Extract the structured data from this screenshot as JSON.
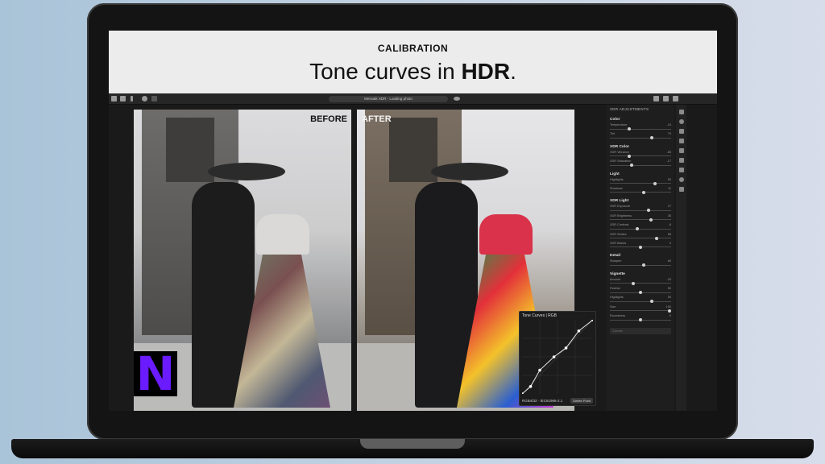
{
  "hero": {
    "eyebrow": "CALIBRATION",
    "title_prefix": "Tone curves in ",
    "title_bold": "HDR",
    "title_suffix": "."
  },
  "app": {
    "status_text": "Messaik XDR - Loading photo",
    "before_label": "BEFORE",
    "after_label": "AFTER",
    "logo_letter": "N",
    "tone_curves": {
      "title": "Tone Curves | RGB",
      "footer": "RGB4/32 · IEC61966-2.1",
      "reset_label": "Delete Point",
      "curve_points": [
        [
          0,
          0
        ],
        [
          0.12,
          0.1
        ],
        [
          0.25,
          0.32
        ],
        [
          0.45,
          0.5
        ],
        [
          0.62,
          0.62
        ],
        [
          0.8,
          0.85
        ],
        [
          1,
          1
        ]
      ]
    },
    "panel": {
      "title": "XDR ADJUSTMENTS",
      "sections": [
        {
          "title": "Color",
          "sliders": [
            {
              "label": "Temperature",
              "value": "-24",
              "pos": 0.3
            },
            {
              "label": "Tint",
              "value": "70",
              "pos": 0.7
            }
          ]
        },
        {
          "title": "XDR Color",
          "sliders": [
            {
              "label": "XDR Vibrance",
              "value": "-65",
              "pos": 0.3
            },
            {
              "label": "XDR Saturation",
              "value": "-17",
              "pos": 0.35
            }
          ]
        },
        {
          "title": "Light",
          "sliders": [
            {
              "label": "Highlights",
              "value": "50",
              "pos": 0.75
            },
            {
              "label": "Shadows",
              "value": "11",
              "pos": 0.55
            }
          ]
        },
        {
          "title": "XDR Light",
          "sliders": [
            {
              "label": "XDR Exposure",
              "value": "27",
              "pos": 0.64
            },
            {
              "label": "XDR Brightness",
              "value": "35",
              "pos": 0.68
            },
            {
              "label": "XDR Contrast",
              "value": "-8",
              "pos": 0.45
            },
            {
              "label": "XDR Whites",
              "value": "56",
              "pos": 0.78
            },
            {
              "label": "XDR Blacks",
              "value": "0",
              "pos": 0.5
            }
          ]
        },
        {
          "title": "Detail",
          "sliders": [
            {
              "label": "Sharpen",
              "value": "60",
              "pos": 0.55
            }
          ]
        },
        {
          "title": "Vignette",
          "sliders": [
            {
              "label": "Amount",
              "value": "-25",
              "pos": 0.38
            },
            {
              "label": "Feather",
              "value": "50",
              "pos": 0.5
            },
            {
              "label": "Highlights",
              "value": "50",
              "pos": 0.7
            },
            {
              "label": "Size",
              "value": "100",
              "pos": 1
            },
            {
              "label": "Roundness",
              "value": "0",
              "pos": 0.5
            }
          ]
        }
      ],
      "field_placeholder": "Curves"
    }
  }
}
